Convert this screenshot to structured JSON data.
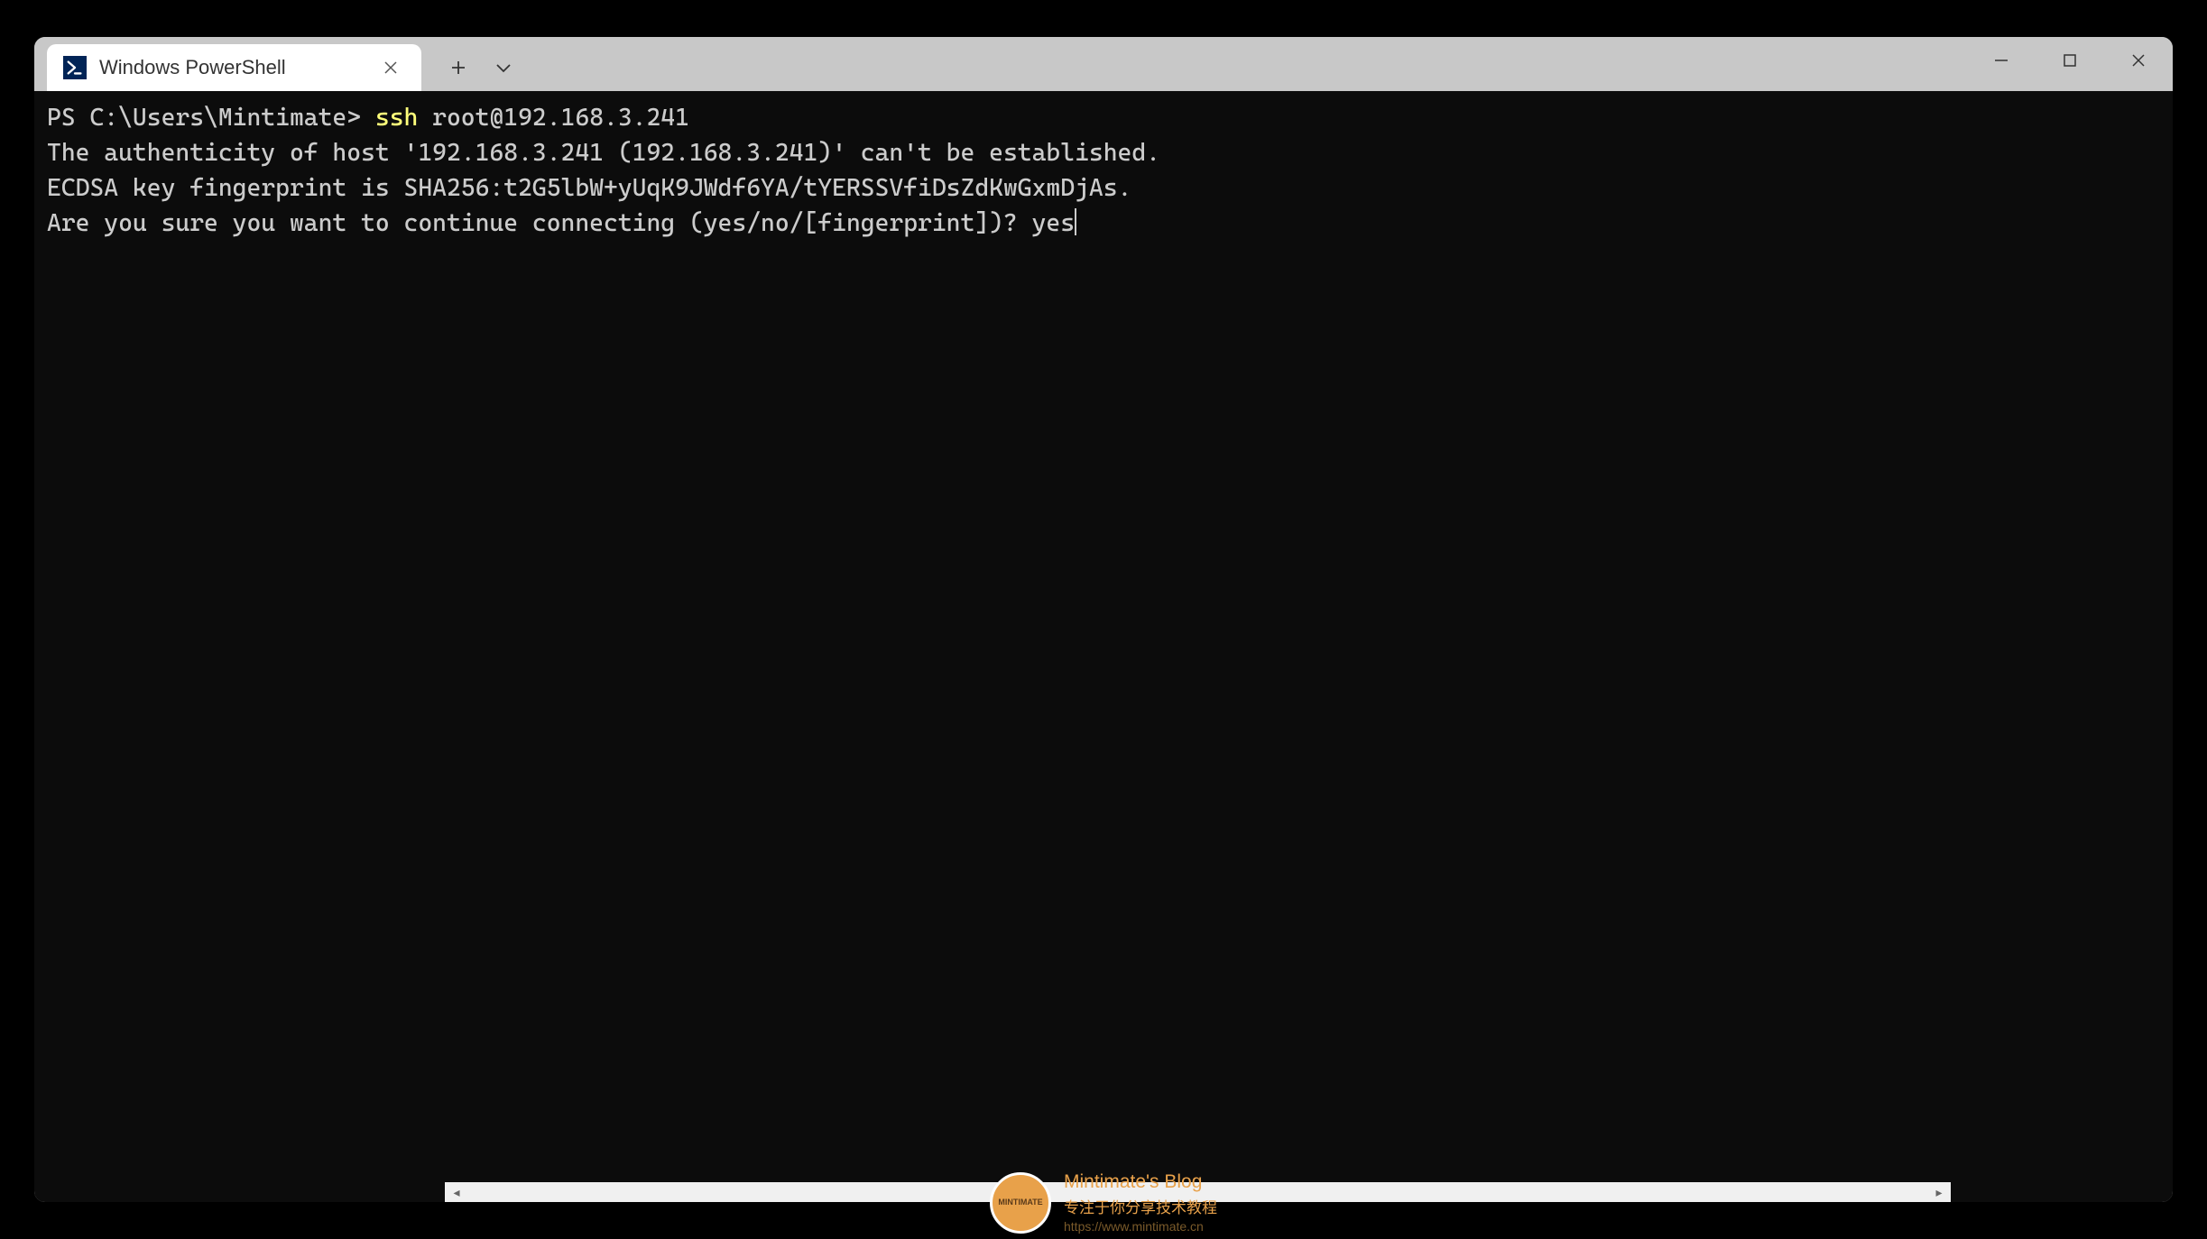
{
  "window": {
    "tab_title": "Windows PowerShell",
    "icon_name": "powershell-icon"
  },
  "terminal": {
    "prompt": "PS C:\\Users\\Mintimate> ",
    "command_keyword": "ssh",
    "command_args": " root@192.168.3.241",
    "lines": [
      "The authenticity of host '192.168.3.241 (192.168.3.241)' can't be established.",
      "ECDSA key fingerprint is SHA256:t2G5lbW+yUqK9JWdf6YA/tYERSSVfiDsZdKwGxmDjAs.",
      "Are you sure you want to continue connecting (yes/no/[fingerprint])? yes"
    ]
  },
  "watermark": {
    "avatar_label": "MINTIMATE",
    "title": "Mintimate's Blog",
    "subtitle": "专注于你分享技术教程",
    "url": "https://www.mintimate.cn"
  }
}
